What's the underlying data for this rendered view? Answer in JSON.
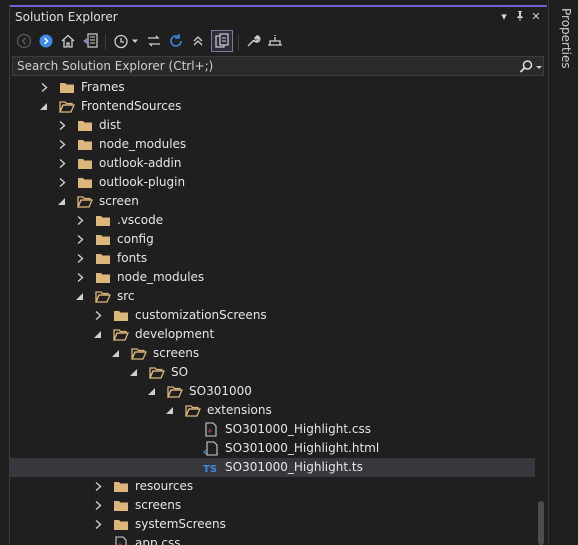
{
  "panel": {
    "title": "Solution Explorer",
    "controls": {
      "dropdown": "▾",
      "pin": "⊣",
      "close": "✕"
    }
  },
  "side_tab": {
    "label": "Properties"
  },
  "search": {
    "placeholder": "Search Solution Explorer (Ctrl+;)"
  },
  "toolbar": {
    "buttons": [
      "back-icon",
      "forward-icon",
      "home-icon",
      "switch-views-icon",
      "history-icon",
      "sync-icon",
      "refresh-icon",
      "collapse-all-icon",
      "show-all-files-icon",
      "properties-icon",
      "preview-icon"
    ]
  },
  "tree": {
    "items": [
      {
        "label": "Frames",
        "type": "folder",
        "expanded": false
      },
      {
        "label": "FrontendSources",
        "type": "folder",
        "expanded": true
      },
      {
        "label": "dist",
        "type": "folder",
        "expanded": false
      },
      {
        "label": "node_modules",
        "type": "folder",
        "expanded": false
      },
      {
        "label": "outlook-addin",
        "type": "folder",
        "expanded": false
      },
      {
        "label": "outlook-plugin",
        "type": "folder",
        "expanded": false
      },
      {
        "label": "screen",
        "type": "folder",
        "expanded": true
      },
      {
        "label": ".vscode",
        "type": "folder",
        "expanded": false
      },
      {
        "label": "config",
        "type": "folder",
        "expanded": false
      },
      {
        "label": "fonts",
        "type": "folder",
        "expanded": false
      },
      {
        "label": "node_modules",
        "type": "folder",
        "expanded": false
      },
      {
        "label": "src",
        "type": "folder",
        "expanded": true
      },
      {
        "label": "customizationScreens",
        "type": "folder",
        "expanded": false
      },
      {
        "label": "development",
        "type": "folder",
        "expanded": true
      },
      {
        "label": "screens",
        "type": "folder",
        "expanded": true
      },
      {
        "label": "SO",
        "type": "folder",
        "expanded": true
      },
      {
        "label": "SO301000",
        "type": "folder",
        "expanded": true
      },
      {
        "label": "extensions",
        "type": "folder",
        "expanded": true
      },
      {
        "label": "SO301000_Highlight.css",
        "type": "css"
      },
      {
        "label": "SO301000_Highlight.html",
        "type": "html"
      },
      {
        "label": "SO301000_Highlight.ts",
        "type": "ts",
        "selected": true
      },
      {
        "label": "resources",
        "type": "folder",
        "expanded": false
      },
      {
        "label": "screens",
        "type": "folder",
        "expanded": false
      },
      {
        "label": "systemScreens",
        "type": "folder",
        "expanded": false
      },
      {
        "label": "app.css",
        "type": "css"
      }
    ]
  },
  "file_badges": {
    "ts": "TS"
  },
  "colors": {
    "background": "#1f1f1f",
    "folder": "#dcb67a",
    "accent": "#6f62d6",
    "selection": "#37373d",
    "ts": "#3c8ce7",
    "css": "#c04060"
  }
}
